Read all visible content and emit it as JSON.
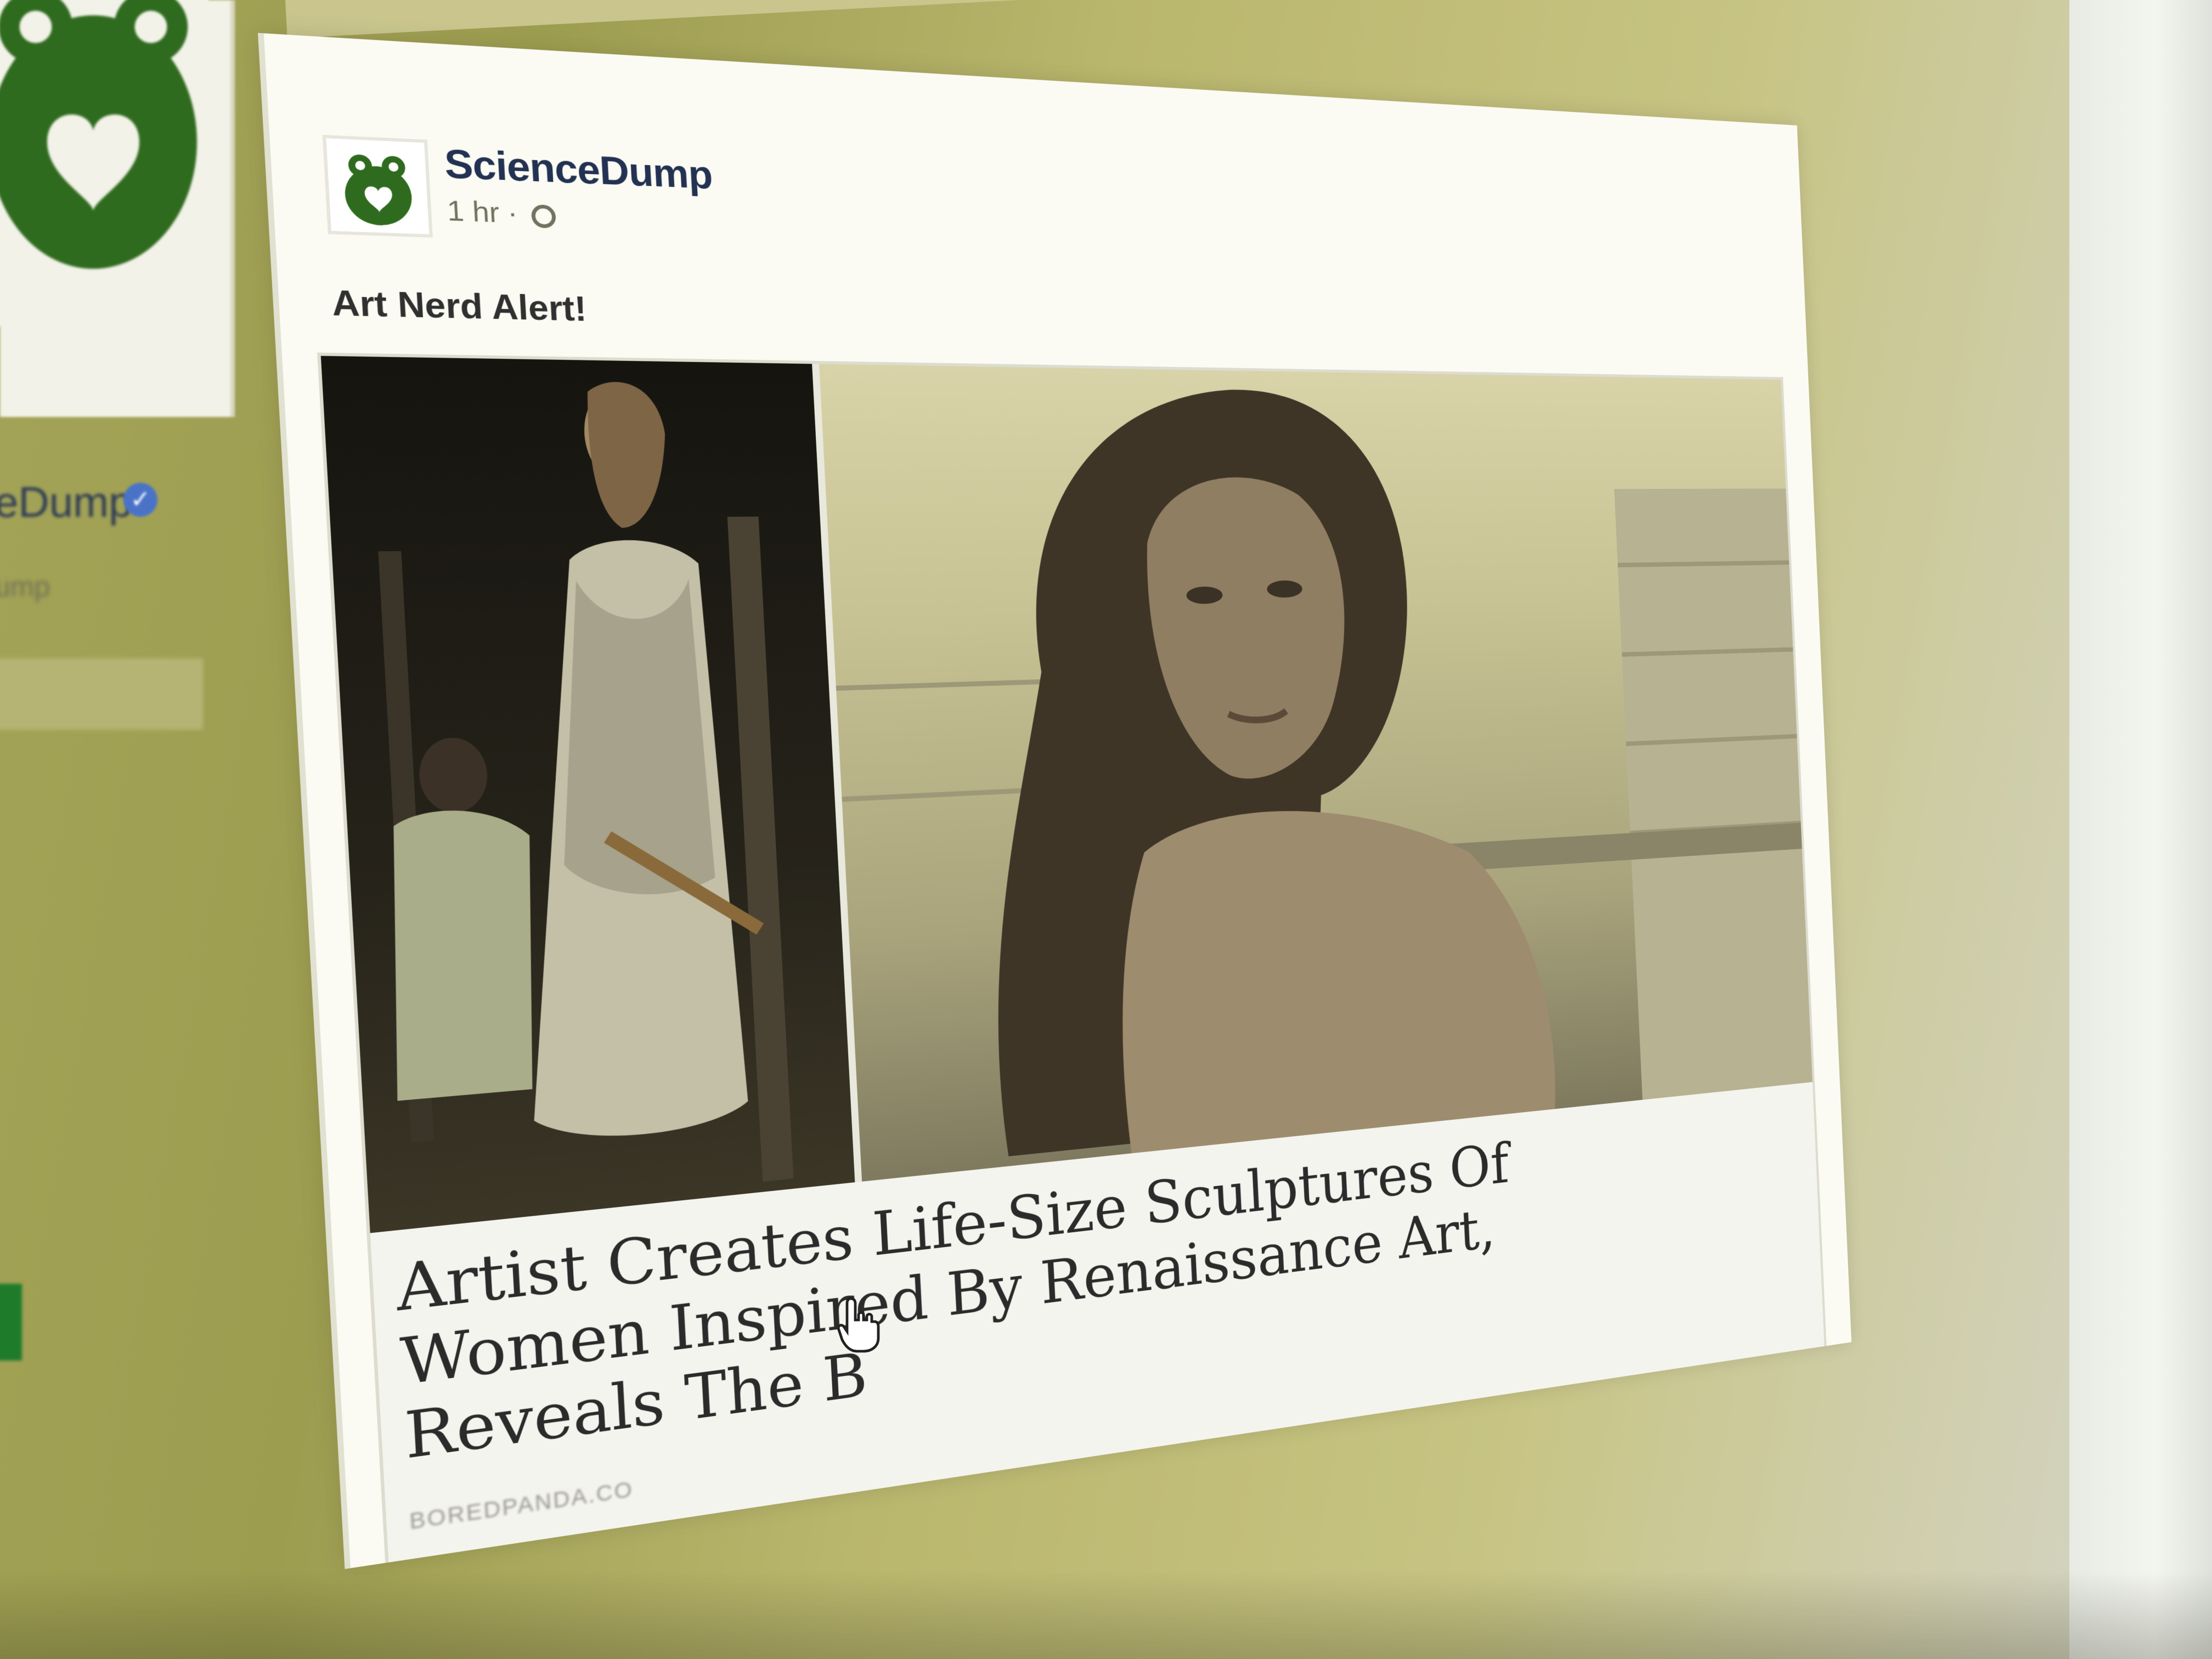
{
  "left_column": {
    "page_name_partial": "eDump",
    "handle_partial": "ump"
  },
  "post": {
    "author": "ScienceDump",
    "time": "1 hr ·",
    "privacy_icon": "globe-icon",
    "text": "Art Nerd Alert!",
    "link_preview": {
      "title": "Artist Creates Life-Size Sculptures Of Women Inspired By Renaissance Art, Reveals The B",
      "source": "BOREDPANDA.CO"
    }
  },
  "colors": {
    "brand_green": "#2f6b1e",
    "author_text": "#233252",
    "verified_badge": "#4a73c8"
  }
}
